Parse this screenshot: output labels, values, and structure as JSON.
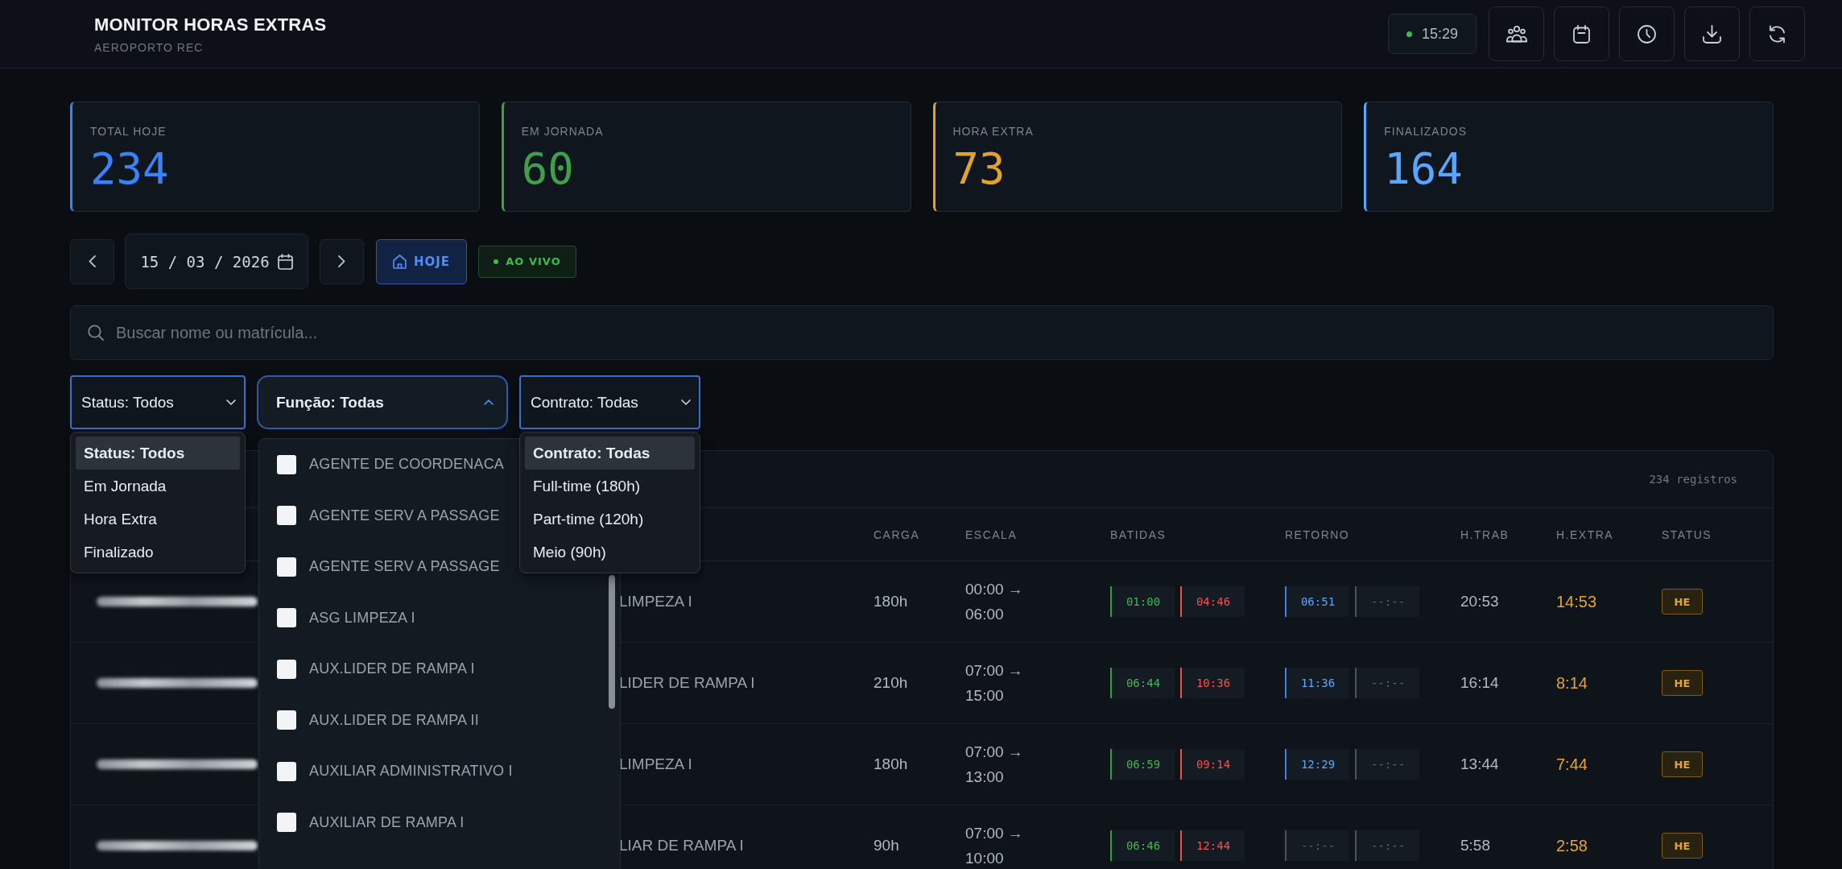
{
  "header": {
    "title": "MONITOR HORAS EXTRAS",
    "subtitle": "AEROPORTO REC",
    "clock": "15:29"
  },
  "stats": [
    {
      "label": "TOTAL HOJE",
      "value": "234",
      "color": "#3b82f6"
    },
    {
      "label": "EM JORNADA",
      "value": "60",
      "color": "#3fa04c"
    },
    {
      "label": "HORA EXTRA",
      "value": "73",
      "color": "#e0a42b"
    },
    {
      "label": "FINALIZADOS",
      "value": "164",
      "color": "#58a6ff"
    }
  ],
  "date_nav": {
    "date": "15 / 03 / 2026",
    "today_button": "HOJE",
    "live_badge": "AO VIVO"
  },
  "search": {
    "placeholder": "Buscar nome ou matrícula..."
  },
  "filters": [
    {
      "kind": "select",
      "label": "Status: Todos",
      "expanded": true,
      "options": [
        {
          "label": "Status: Todos",
          "selected": true
        },
        {
          "label": "Em Jornada",
          "selected": false
        },
        {
          "label": "Hora Extra",
          "selected": false
        },
        {
          "label": "Finalizado",
          "selected": false
        }
      ]
    },
    {
      "kind": "checklist",
      "label": "Função: Todas",
      "expanded": true,
      "options": [
        {
          "label": "AGENTE DE COORDENACA",
          "checked": false
        },
        {
          "label": "AGENTE SERV A PASSAGE",
          "checked": false
        },
        {
          "label": "AGENTE SERV A PASSAGE",
          "checked": false
        },
        {
          "label": "ASG LIMPEZA I",
          "checked": false
        },
        {
          "label": "AUX.LIDER DE RAMPA I",
          "checked": false
        },
        {
          "label": "AUX.LIDER DE RAMPA II",
          "checked": false
        },
        {
          "label": "AUXILIAR ADMINISTRATIVO I",
          "checked": false
        },
        {
          "label": "AUXILIAR DE RAMPA I",
          "checked": false
        }
      ]
    },
    {
      "kind": "select",
      "label": "Contrato: Todas",
      "expanded": true,
      "options": [
        {
          "label": "Contrato: Todas",
          "selected": true
        },
        {
          "label": "Full-time (180h)",
          "selected": false
        },
        {
          "label": "Part-time (120h)",
          "selected": false
        },
        {
          "label": "Meio (90h)",
          "selected": false
        }
      ]
    }
  ],
  "table": {
    "count": "234 registros",
    "columns": [
      "CARGA",
      "ESCALA",
      "BATIDAS",
      "RETORNO",
      "H.TRAB",
      "H.EXTRA",
      "STATUS"
    ],
    "rows": [
      {
        "role": "LIMPEZA I",
        "carga": "180h",
        "escala": "00:00 → 06:00",
        "batidas": [
          {
            "time": "01:00",
            "kind": "in"
          },
          {
            "time": "04:46",
            "kind": "out"
          }
        ],
        "retorno": [
          {
            "time": "06:51",
            "kind": "return"
          },
          {
            "time": "--:--",
            "kind": "empty"
          }
        ],
        "h_trab": "20:53",
        "h_extra": "14:53",
        "status": {
          "label": "HE",
          "kind": "overtime"
        }
      },
      {
        "role": "LIDER DE RAMPA I",
        "carga": "210h",
        "escala": "07:00 → 15:00",
        "batidas": [
          {
            "time": "06:44",
            "kind": "in"
          },
          {
            "time": "10:36",
            "kind": "out"
          }
        ],
        "retorno": [
          {
            "time": "11:36",
            "kind": "return"
          },
          {
            "time": "--:--",
            "kind": "empty"
          }
        ],
        "h_trab": "16:14",
        "h_extra": "8:14",
        "status": {
          "label": "HE",
          "kind": "overtime"
        }
      },
      {
        "role": "LIMPEZA I",
        "carga": "180h",
        "escala": "07:00 → 13:00",
        "batidas": [
          {
            "time": "06:59",
            "kind": "in"
          },
          {
            "time": "09:14",
            "kind": "out"
          }
        ],
        "retorno": [
          {
            "time": "12:29",
            "kind": "return"
          },
          {
            "time": "--:--",
            "kind": "empty"
          }
        ],
        "h_trab": "13:44",
        "h_extra": "7:44",
        "status": {
          "label": "HE",
          "kind": "overtime"
        }
      },
      {
        "role": "LIAR DE RAMPA I",
        "carga": "90h",
        "escala": "07:00 → 10:00",
        "batidas": [
          {
            "time": "06:46",
            "kind": "in"
          },
          {
            "time": "12:44",
            "kind": "out"
          }
        ],
        "retorno": [
          {
            "time": "--:--",
            "kind": "empty"
          },
          {
            "time": "--:--",
            "kind": "empty"
          }
        ],
        "h_trab": "5:58",
        "h_extra": "2:58",
        "status": {
          "label": "HE",
          "kind": "overtime"
        }
      }
    ]
  }
}
